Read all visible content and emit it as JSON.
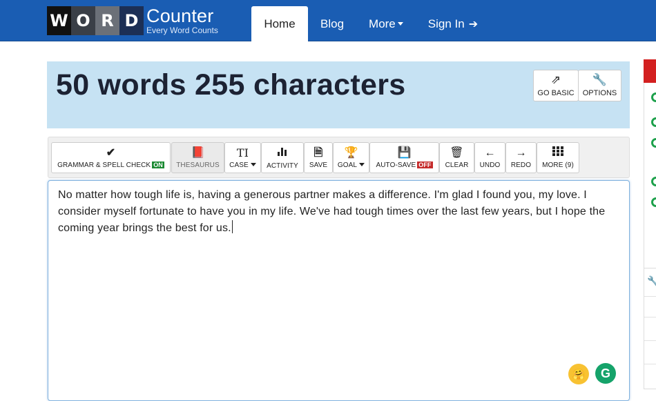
{
  "logo": {
    "tiles": [
      "W",
      "O",
      "R",
      "D"
    ],
    "brand": "Counter",
    "tagline": "Every Word Counts"
  },
  "nav": {
    "home": "Home",
    "blog": "Blog",
    "more": "More",
    "signin": "Sign In"
  },
  "banner": {
    "count_text": "50 words 255 characters",
    "go_basic": "GO BASIC",
    "options": "OPTIONS"
  },
  "toolbar": {
    "grammar": "GRAMMAR & SPELL CHECK",
    "grammar_state": "ON",
    "thesaurus": "THESAURUS",
    "case": "CASE",
    "activity": "ACTIVITY",
    "save": "SAVE",
    "goal": "GOAL",
    "autosave": "AUTO-SAVE",
    "autosave_state": "OFF",
    "clear": "CLEAR",
    "undo": "UNDO",
    "redo": "REDO",
    "more": "MORE (9)"
  },
  "editor": {
    "text": "No matter how tough life is, having a generous partner makes a difference. I'm glad I found you, my love. I consider myself fortunate to have you in my life. We've had tough times over the last few years, but I hope the coming year brings the best for us."
  },
  "icons": {
    "signin": "sign-in-icon",
    "external": "external-link-icon",
    "wrench": "wrench-icon",
    "check": "check-icon",
    "book": "book-icon",
    "text_case": "text-case-icon",
    "bar_chart": "bar-chart-icon",
    "save": "save-file-icon",
    "trophy": "trophy-icon",
    "floppy": "floppy-disk-icon",
    "trash": "trash-icon",
    "arrow_left": "arrow-left-icon",
    "arrow_right": "arrow-right-icon",
    "grid": "grid-icon",
    "emoji": "hug-emoji-icon",
    "grammarly": "grammarly-icon"
  },
  "colors": {
    "nav_bg": "#1a5db3",
    "banner_bg": "#c6e2f3",
    "on_badge": "#1a8a32",
    "off_badge": "#c52b2b",
    "side_accent": "#d32020",
    "status_dot": "#1ea14c"
  }
}
